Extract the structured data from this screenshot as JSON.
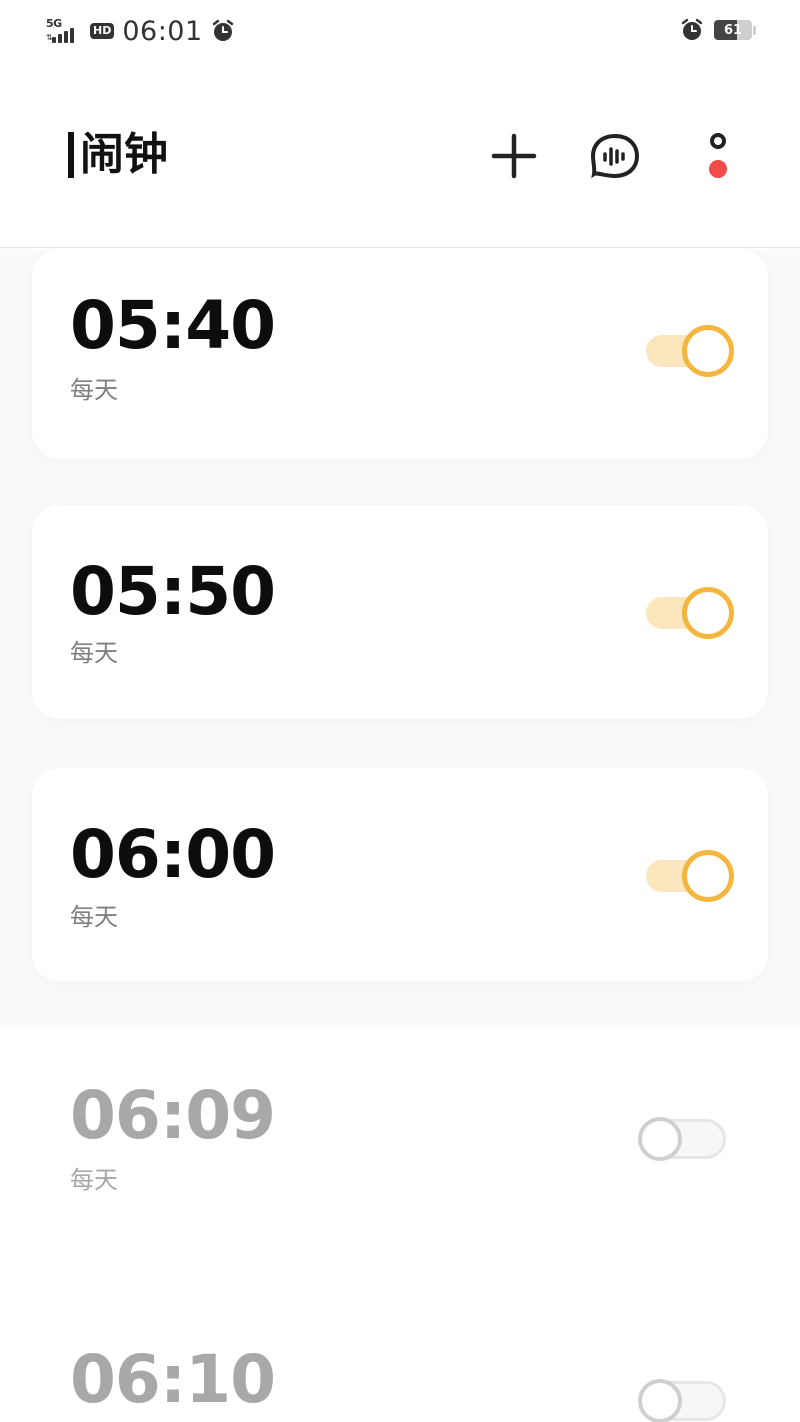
{
  "status_bar": {
    "network": "5G",
    "hd": "HD",
    "time": "06:01",
    "battery": "61",
    "battery_level": 0.61,
    "icons": [
      "signal-icon",
      "hd-icon",
      "alarm-icon",
      "battery-icon"
    ]
  },
  "header": {
    "title": "闹钟",
    "icons": [
      "add-icon",
      "voice-assistant-icon",
      "more-icon"
    ],
    "more_dot_color": "#f24a4a"
  },
  "alarms": [
    {
      "time": "05:40",
      "repeat": "每天",
      "enabled": true
    },
    {
      "time": "05:50",
      "repeat": "每天",
      "enabled": true
    },
    {
      "time": "06:00",
      "repeat": "每天",
      "enabled": true
    },
    {
      "time": "06:09",
      "repeat": "每天",
      "enabled": false
    },
    {
      "time": "06:10",
      "repeat": "",
      "enabled": false
    }
  ],
  "colors": {
    "toggle_on_knob": "#f4b63e",
    "toggle_on_track": "#fbe6bd",
    "toggle_off": "#cfcfcf",
    "text_primary": "#0d0d0d",
    "text_disabled": "#a8a8a8"
  }
}
